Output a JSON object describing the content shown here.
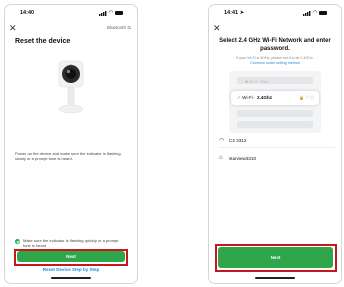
{
  "left": {
    "status": {
      "time": "14:40"
    },
    "top_right_link": "Bluetooth",
    "title": "Reset the device",
    "description": "Power on the device and make sure the indicator is flashing slowly or a prompt tone is heard.",
    "confirm_text": "Make sure the indicator is flashing quickly or a prompt tone is heard",
    "next_label": "Next",
    "bottom_link": "Reset Device Step by Step"
  },
  "right": {
    "status": {
      "time": "14:41"
    },
    "title": "Select 2.4 GHz Wi-Fi Network and enter password.",
    "subtitle": "If your Wi-Fi is 5GHz, please set it to be 2.4GHz.",
    "subtitle_link": "Common router setting method",
    "illus_bad": "Wi-Fi · 5Ghz",
    "illus_good_prefix": "Wi-Fi ·",
    "illus_good_band": "2.4Ghz",
    "networks": [
      {
        "name": "C2 3312",
        "meta": "",
        "icon": "wifi-icon"
      },
      {
        "name": "starview3310",
        "meta": "",
        "icon": "lock-icon"
      }
    ],
    "next_label": "Next"
  },
  "colors": {
    "accent_green": "#2fa64a",
    "highlight_red": "#c4181b",
    "link_blue": "#1f86d8"
  }
}
